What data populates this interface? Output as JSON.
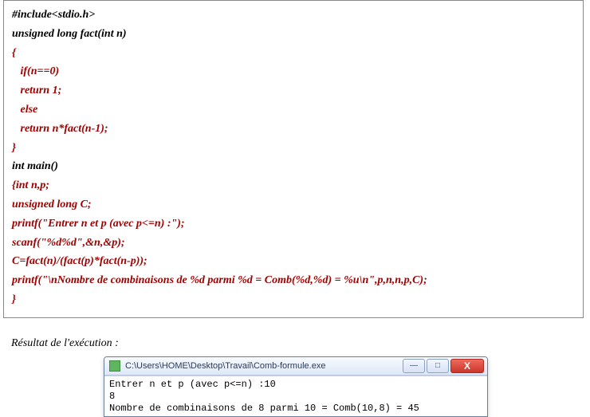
{
  "code": {
    "lines": [
      {
        "text": "#include<stdio.h>",
        "cls": "black"
      },
      {
        "text": "unsigned long fact(int n)",
        "cls": "black"
      },
      {
        "text": "{",
        "cls": "red"
      },
      {
        "text": "   if(n==0)",
        "cls": "red"
      },
      {
        "text": "   return 1;",
        "cls": "red"
      },
      {
        "text": "   else",
        "cls": "red"
      },
      {
        "text": "   return n*fact(n-1);",
        "cls": "red"
      },
      {
        "text": "}",
        "cls": "red"
      },
      {
        "text": "int main()",
        "cls": "black"
      },
      {
        "text": "{int n,p;",
        "cls": "red"
      },
      {
        "text": "unsigned long C;",
        "cls": "red"
      },
      {
        "text": "printf(\"Entrer n et p (avec p<=n) :\");",
        "cls": "red"
      },
      {
        "text": "scanf(\"%d%d\",&n,&p);",
        "cls": "red"
      },
      {
        "text": "C=fact(n)/(fact(p)*fact(n-p));",
        "cls": "red"
      },
      {
        "text": "printf(\"\\nNombre de combinaisons de %d parmi %d = Comb(%d,%d) = %u\\n\",p,n,n,p,C);",
        "cls": "red"
      },
      {
        "text": "}",
        "cls": "red"
      }
    ]
  },
  "result_label": "Résultat de l'exécution :",
  "console": {
    "title": "C:\\Users\\HOME\\Desktop\\Travail\\Comb-formule.exe",
    "buttons": {
      "minimize": "—",
      "maximize": "□",
      "close": "X"
    },
    "lines": [
      "Entrer n et p (avec p<=n) :10",
      "8",
      "",
      "Nombre de combinaisons de 8 parmi 10 = Comb(10,8) = 45",
      ""
    ]
  }
}
